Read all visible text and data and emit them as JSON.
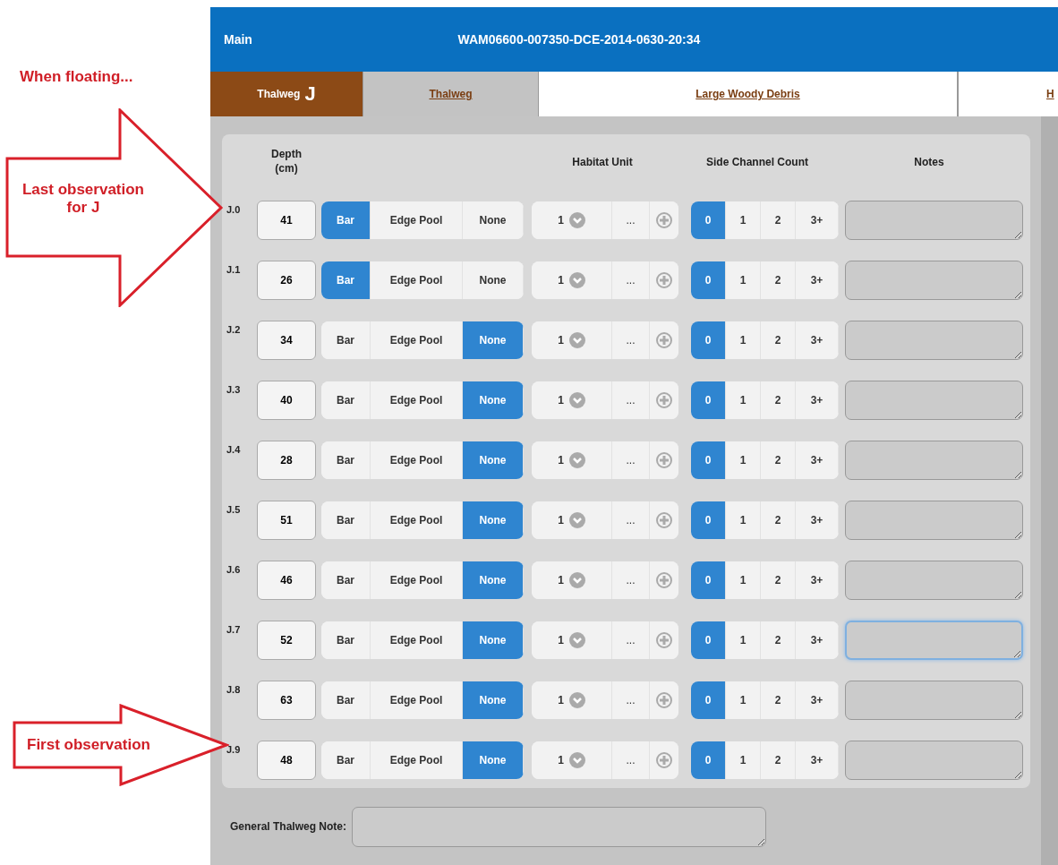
{
  "annotations": [
    {
      "kind": "caption",
      "text": "When floating..."
    },
    {
      "kind": "big_arrow",
      "text": "Last observation for J"
    },
    {
      "kind": "small_arrow",
      "text": "First observation"
    }
  ],
  "header": {
    "title": "Main",
    "record": "WAM06600-007350-DCE-2014-0630-20:34"
  },
  "tabs": [
    {
      "kind": "marker",
      "label": "Thalweg",
      "letter": "J"
    },
    {
      "kind": "link",
      "label": "Thalweg",
      "selected": true
    },
    {
      "kind": "link",
      "label": "Large Woody Debris",
      "selected": false
    },
    {
      "kind": "link",
      "label": "H",
      "selected": false
    }
  ],
  "columns": [
    "Depth (cm)",
    "Habitat Unit",
    "Side Channel Count",
    "Notes"
  ],
  "rows": [
    {
      "label": "J.0",
      "depth": "41",
      "location": [
        {
          "label": "Bar",
          "selected": true
        },
        {
          "label": "Edge Pool",
          "selected": false
        },
        {
          "label": "None",
          "selected": false
        }
      ],
      "habitat": "1",
      "more": "...",
      "side_channels": [
        {
          "label": "0",
          "selected": true
        },
        {
          "label": "1",
          "selected": false
        },
        {
          "label": "2",
          "selected": false
        },
        {
          "label": "3+",
          "selected": false
        }
      ],
      "notes_focused": false
    },
    {
      "label": "J.1",
      "depth": "26",
      "location": [
        {
          "label": "Bar",
          "selected": true
        },
        {
          "label": "Edge Pool",
          "selected": false
        },
        {
          "label": "None",
          "selected": false
        }
      ],
      "habitat": "1",
      "more": "...",
      "side_channels": [
        {
          "label": "0",
          "selected": true
        },
        {
          "label": "1",
          "selected": false
        },
        {
          "label": "2",
          "selected": false
        },
        {
          "label": "3+",
          "selected": false
        }
      ],
      "notes_focused": false
    },
    {
      "label": "J.2",
      "depth": "34",
      "location": [
        {
          "label": "Bar",
          "selected": false
        },
        {
          "label": "Edge Pool",
          "selected": false
        },
        {
          "label": "None",
          "selected": true
        }
      ],
      "habitat": "1",
      "more": "...",
      "side_channels": [
        {
          "label": "0",
          "selected": true
        },
        {
          "label": "1",
          "selected": false
        },
        {
          "label": "2",
          "selected": false
        },
        {
          "label": "3+",
          "selected": false
        }
      ],
      "notes_focused": false
    },
    {
      "label": "J.3",
      "depth": "40",
      "location": [
        {
          "label": "Bar",
          "selected": false
        },
        {
          "label": "Edge Pool",
          "selected": false
        },
        {
          "label": "None",
          "selected": true
        }
      ],
      "habitat": "1",
      "more": "...",
      "side_channels": [
        {
          "label": "0",
          "selected": true
        },
        {
          "label": "1",
          "selected": false
        },
        {
          "label": "2",
          "selected": false
        },
        {
          "label": "3+",
          "selected": false
        }
      ],
      "notes_focused": false
    },
    {
      "label": "J.4",
      "depth": "28",
      "location": [
        {
          "label": "Bar",
          "selected": false
        },
        {
          "label": "Edge Pool",
          "selected": false
        },
        {
          "label": "None",
          "selected": true
        }
      ],
      "habitat": "1",
      "more": "...",
      "side_channels": [
        {
          "label": "0",
          "selected": true
        },
        {
          "label": "1",
          "selected": false
        },
        {
          "label": "2",
          "selected": false
        },
        {
          "label": "3+",
          "selected": false
        }
      ],
      "notes_focused": false
    },
    {
      "label": "J.5",
      "depth": "51",
      "location": [
        {
          "label": "Bar",
          "selected": false
        },
        {
          "label": "Edge Pool",
          "selected": false
        },
        {
          "label": "None",
          "selected": true
        }
      ],
      "habitat": "1",
      "more": "...",
      "side_channels": [
        {
          "label": "0",
          "selected": true
        },
        {
          "label": "1",
          "selected": false
        },
        {
          "label": "2",
          "selected": false
        },
        {
          "label": "3+",
          "selected": false
        }
      ],
      "notes_focused": false
    },
    {
      "label": "J.6",
      "depth": "46",
      "location": [
        {
          "label": "Bar",
          "selected": false
        },
        {
          "label": "Edge Pool",
          "selected": false
        },
        {
          "label": "None",
          "selected": true
        }
      ],
      "habitat": "1",
      "more": "...",
      "side_channels": [
        {
          "label": "0",
          "selected": true
        },
        {
          "label": "1",
          "selected": false
        },
        {
          "label": "2",
          "selected": false
        },
        {
          "label": "3+",
          "selected": false
        }
      ],
      "notes_focused": false
    },
    {
      "label": "J.7",
      "depth": "52",
      "location": [
        {
          "label": "Bar",
          "selected": false
        },
        {
          "label": "Edge Pool",
          "selected": false
        },
        {
          "label": "None",
          "selected": true
        }
      ],
      "habitat": "1",
      "more": "...",
      "side_channels": [
        {
          "label": "0",
          "selected": true
        },
        {
          "label": "1",
          "selected": false
        },
        {
          "label": "2",
          "selected": false
        },
        {
          "label": "3+",
          "selected": false
        }
      ],
      "notes_focused": true
    },
    {
      "label": "J.8",
      "depth": "63",
      "location": [
        {
          "label": "Bar",
          "selected": false
        },
        {
          "label": "Edge Pool",
          "selected": false
        },
        {
          "label": "None",
          "selected": true
        }
      ],
      "habitat": "1",
      "more": "...",
      "side_channels": [
        {
          "label": "0",
          "selected": true
        },
        {
          "label": "1",
          "selected": false
        },
        {
          "label": "2",
          "selected": false
        },
        {
          "label": "3+",
          "selected": false
        }
      ],
      "notes_focused": false
    },
    {
      "label": "J.9",
      "depth": "48",
      "location": [
        {
          "label": "Bar",
          "selected": false
        },
        {
          "label": "Edge Pool",
          "selected": false
        },
        {
          "label": "None",
          "selected": true
        }
      ],
      "habitat": "1",
      "more": "...",
      "side_channels": [
        {
          "label": "0",
          "selected": true
        },
        {
          "label": "1",
          "selected": false
        },
        {
          "label": "2",
          "selected": false
        },
        {
          "label": "3+",
          "selected": false
        }
      ],
      "notes_focused": false
    }
  ],
  "general_note": {
    "label": "General Thalweg Note:"
  }
}
